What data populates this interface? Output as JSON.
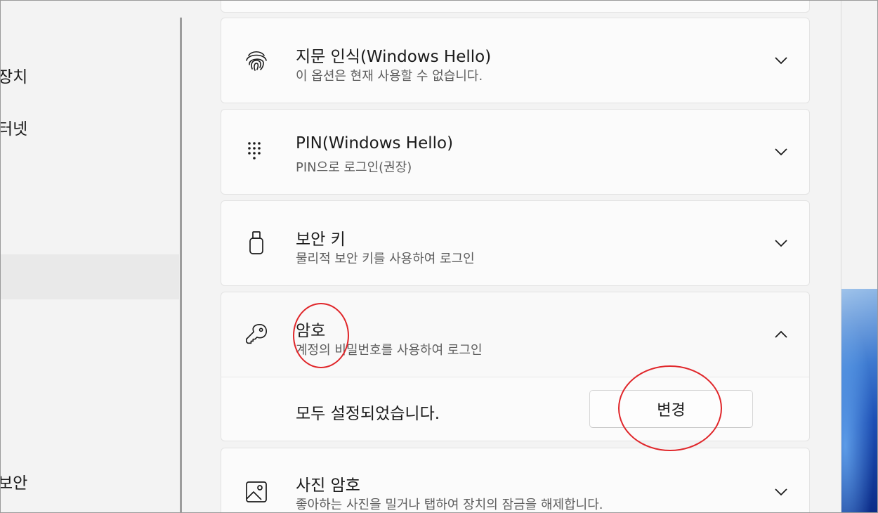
{
  "nav": {
    "items": [
      {
        "label": "장치"
      },
      {
        "label": "터넷"
      },
      {
        "label": "보안"
      }
    ]
  },
  "options": {
    "fingerprint": {
      "title": "지문 인식(Windows Hello)",
      "subtitle": "이 옵션은 현재 사용할 수 없습니다.",
      "icon": "fingerprint-icon"
    },
    "pin": {
      "title": "PIN(Windows Hello)",
      "subtitle": "PIN으로 로그인(권장)",
      "icon": "keypad-icon"
    },
    "security_key": {
      "title": "보안 키",
      "subtitle": "물리적 보안 키를 사용하여 로그인",
      "icon": "usb-key-icon"
    },
    "password": {
      "title": "암호",
      "subtitle": "계정의 비밀번호를 사용하여 로그인",
      "icon": "key-icon",
      "status_text": "모두 설정되었습니다.",
      "change_label": "변경"
    },
    "picture_password": {
      "title": "사진 암호",
      "subtitle": "좋아하는 사진을 밀거나 탭하여 장치의 잠금을 해제합니다.",
      "icon": "picture-icon"
    }
  },
  "colors": {
    "annotation": "#e0262a",
    "card_bg": "#fbfbfb",
    "page_bg": "#f3f3f3"
  }
}
